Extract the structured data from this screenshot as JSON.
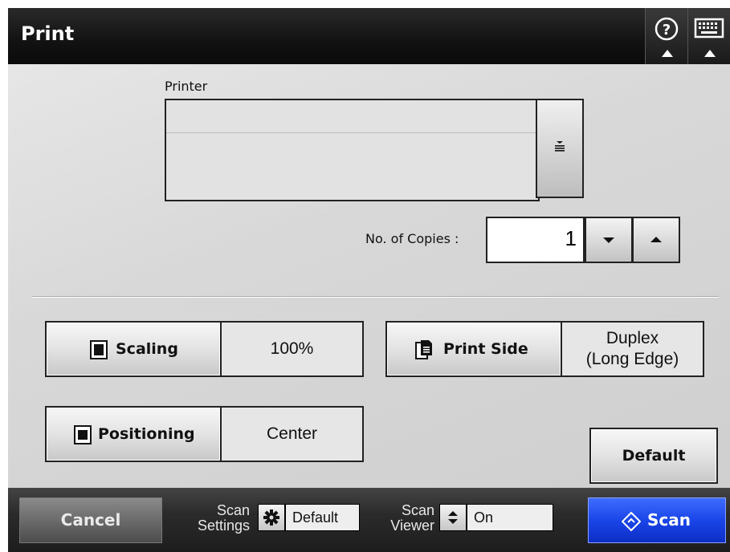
{
  "window": {
    "title": "Print"
  },
  "titlebar": {
    "help_icon": "help-icon",
    "keyboard_icon": "keyboard-icon"
  },
  "printer": {
    "label": "Printer",
    "value": "",
    "dropdown_icon": "list-icon"
  },
  "copies": {
    "label": "No. of Copies :",
    "value": "1",
    "down_icon": "chevron-down-icon",
    "up_icon": "chevron-up-icon"
  },
  "options": {
    "scaling": {
      "label": "Scaling",
      "value": "100%",
      "icon": "scaling-icon"
    },
    "print_side": {
      "label": "Print Side",
      "value_line1": "Duplex",
      "value_line2": "(Long Edge)",
      "icon": "pages-icon"
    },
    "positioning": {
      "label": "Positioning",
      "value": "Center",
      "icon": "positioning-icon"
    }
  },
  "default_button": {
    "label": "Default"
  },
  "bottombar": {
    "cancel": "Cancel",
    "scan_settings": {
      "label_line1": "Scan",
      "label_line2": "Settings",
      "value": "Default",
      "icon": "gear-icon"
    },
    "scan_viewer": {
      "label_line1": "Scan",
      "label_line2": "Viewer",
      "value": "On",
      "icon": "updown-icon"
    },
    "scan": {
      "label": "Scan",
      "icon": "scan-diamond-icon"
    }
  },
  "colors": {
    "scan_button": "#1a45e8",
    "titlebar": "#121212",
    "background": "#dcdcdc"
  }
}
